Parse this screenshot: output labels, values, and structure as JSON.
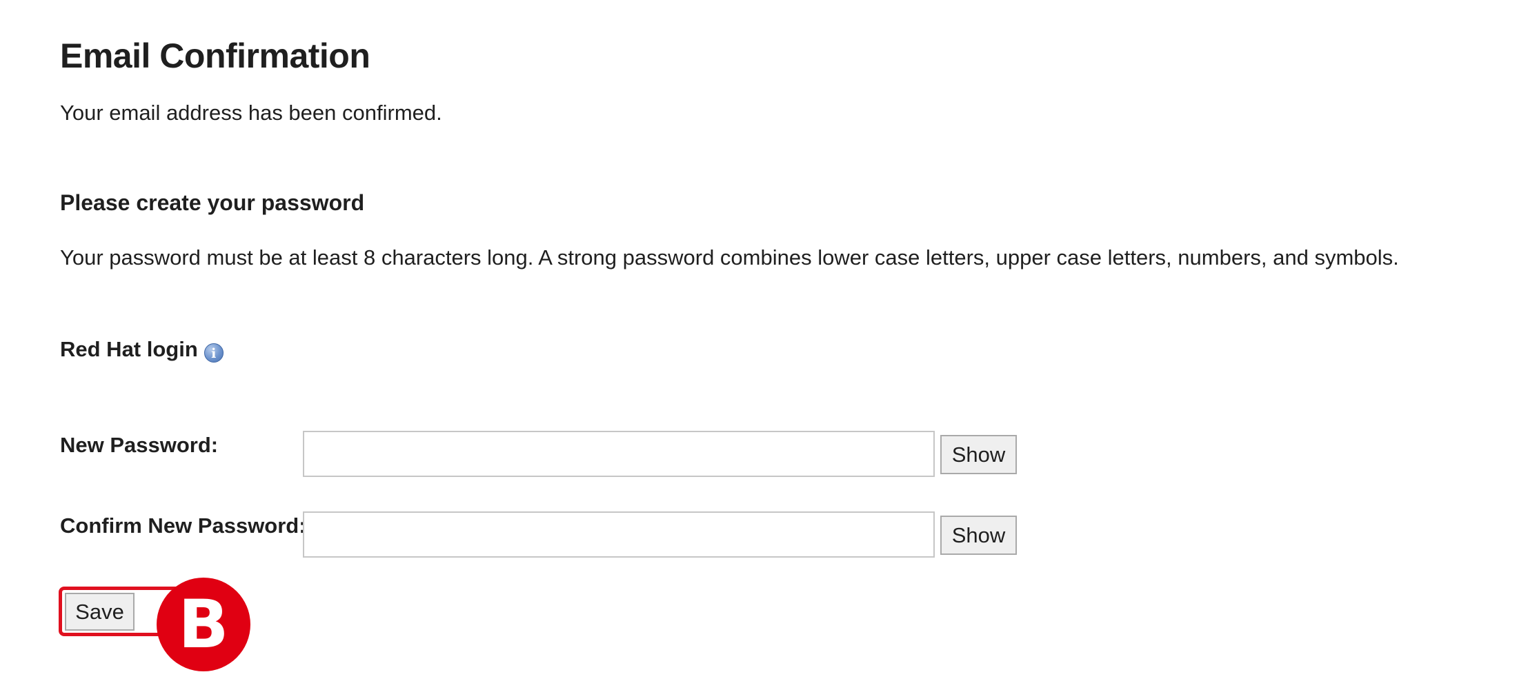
{
  "page": {
    "title": "Email Confirmation",
    "confirmation_message": "Your email address has been confirmed."
  },
  "password_section": {
    "heading": "Please create your password",
    "rules": "Your password must be at least 8 characters long. A strong password combines lower case letters, upper case letters, numbers, and symbols."
  },
  "login": {
    "label": "Red Hat login",
    "info_icon": "info-icon",
    "info_glyph": "i"
  },
  "form": {
    "new_password": {
      "label": "New Password:",
      "value": "",
      "show_label": "Show"
    },
    "confirm_password": {
      "label": "Confirm New Password:",
      "value": "",
      "show_label": "Show"
    },
    "save_label": "Save"
  },
  "annotation": {
    "marker_letter": "B",
    "highlight_color": "#e0101f",
    "marker_color": "#e00012"
  }
}
